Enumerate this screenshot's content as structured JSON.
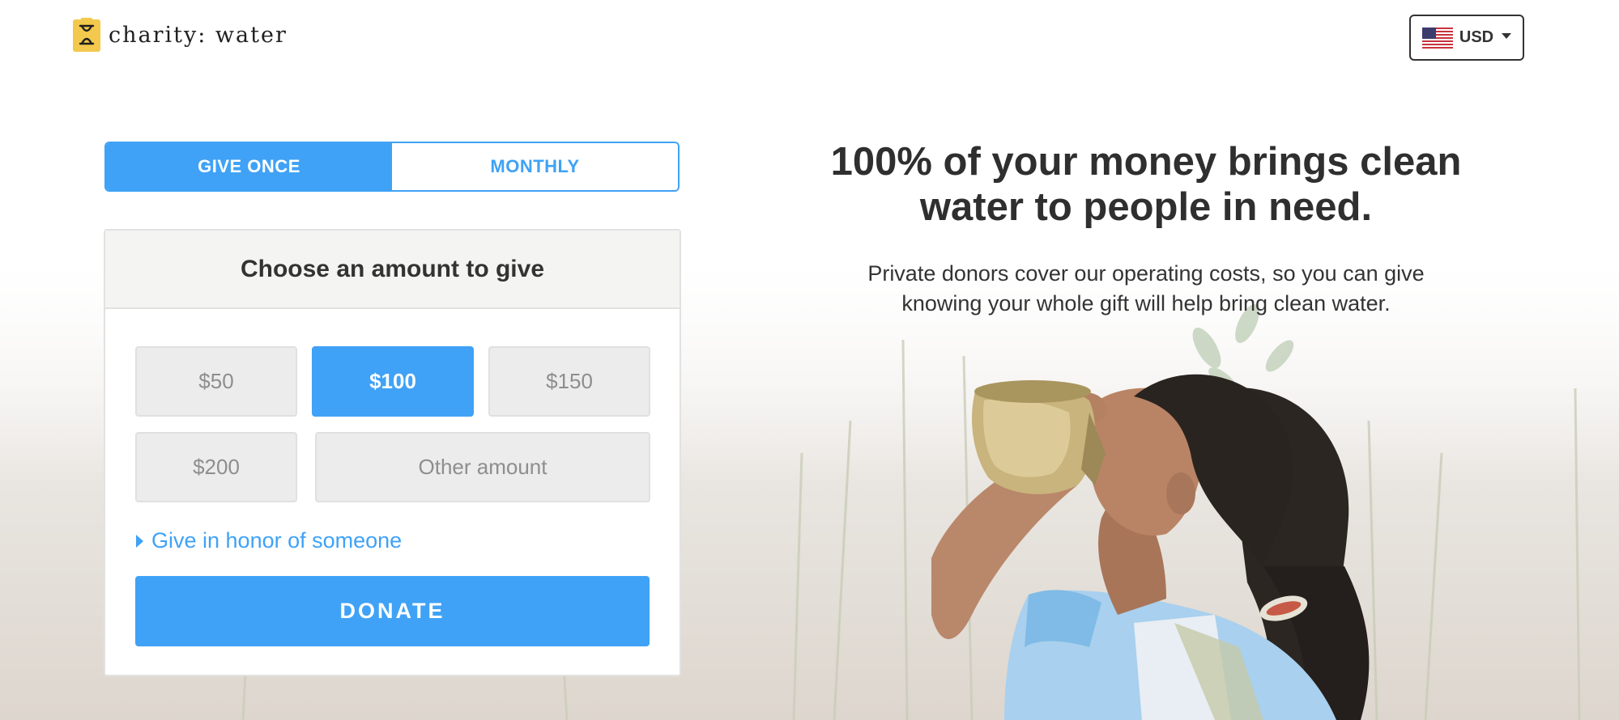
{
  "header": {
    "logo_text": "charity: water",
    "currency_label": "USD",
    "currency_icon": "us-flag-icon"
  },
  "frequency": {
    "options": [
      "GIVE ONCE",
      "MONTHLY"
    ],
    "selected": "GIVE ONCE"
  },
  "form": {
    "title": "Choose an amount to give",
    "amounts": [
      "$50",
      "$100",
      "$150",
      "$200"
    ],
    "selected_amount": "$100",
    "other_amount_placeholder": "Other amount",
    "honor_link": "Give in honor of someone",
    "donate_label": "DONATE"
  },
  "hero": {
    "headline_line1": "100% of your money brings clean",
    "headline_line2": "water to people in need.",
    "subcopy_line1": "Private donors cover our operating costs, so you can give",
    "subcopy_line2": "knowing your whole gift will help bring clean water."
  },
  "colors": {
    "accent": "#3fa2f6",
    "logo_yellow": "#f2c94c"
  }
}
